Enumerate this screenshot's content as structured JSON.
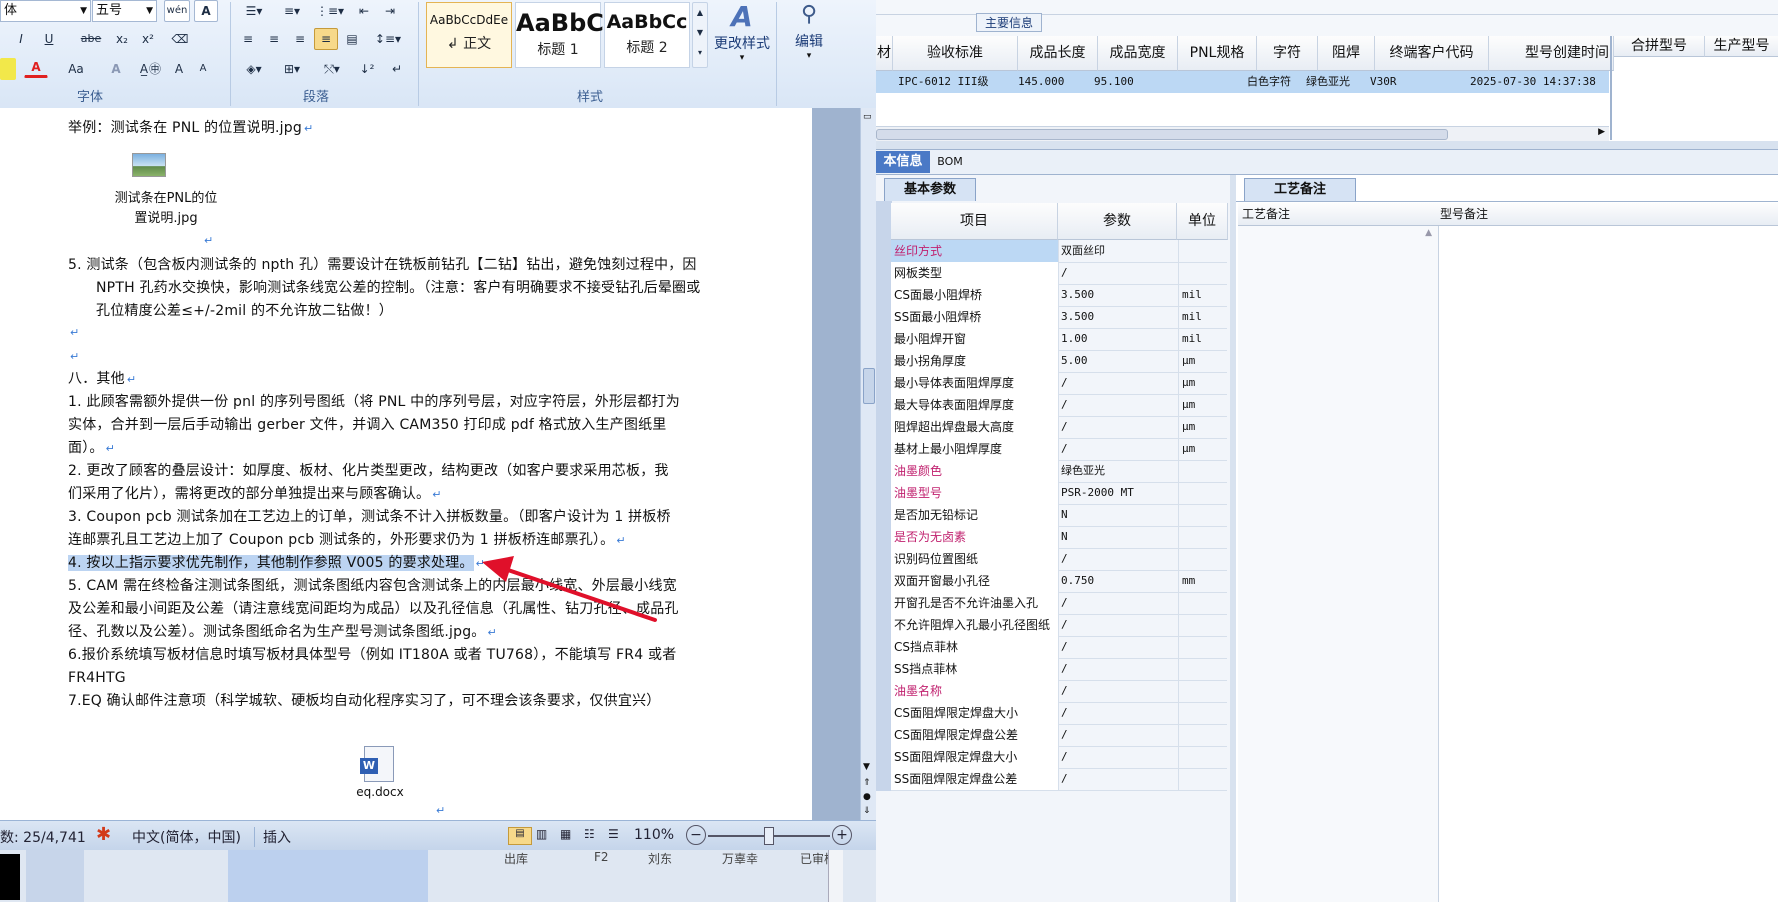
{
  "ribbon": {
    "font_name": "体",
    "font_size": "五号",
    "group_font": "字体",
    "group_paragraph": "段落",
    "group_styles": "样式",
    "styles": [
      {
        "sample": "AaBbCcDdEe",
        "name": "↲ 正文"
      },
      {
        "sample": "AaBbC",
        "name": "标题 1"
      },
      {
        "sample": "AaBbCc",
        "name": "标题 2"
      }
    ],
    "change_styles": "更改样式",
    "edit": "编辑",
    "btn_bold_i": "I",
    "btn_u": "U",
    "btn_abe": "abe",
    "btn_sub": "x₂",
    "btn_sup": "x²",
    "btn_aa": "Aa",
    "btn_grow": "A",
    "btn_shrink": "A"
  },
  "doc": {
    "p1": "举例：测试条在 PNL 的位置说明.jpg",
    "img_caption_1": "测试条在PNL的位",
    "img_caption_2": "置说明.jpg",
    "p5": "5.  测试条（包含板内测试条的 npth 孔）需要设计在铣板前钻孔【二钻】钻出，避免蚀刻过程中，因 NPTH 孔药水交换快，影响测试条线宽公差的控制。（注意：客户有明确要求不接受钻孔后晕圈或孔位精度公差≤+/-2mil 的不允许放二钻做！）",
    "h8": "八．其他",
    "o1": "1.  此顾客需额外提供一份 pnl 的序列号图纸（将 PNL 中的序列号层，对应字符层，外形层都打为实体，合并到一层后手动输出 gerber 文件，并调入 CAM350 打印成 pdf 格式放入生产图纸里面）。",
    "o2": "2.  更改了顾客的叠层设计：如厚度、板材、化片类型更改，结构更改（如客户要求采用芯板，我们采用了化片），需将更改的部分单独提出来与顾客确认。",
    "o3": "3.  Coupon pcb 测试条加在工艺边上的订单，测试条不计入拼板数量。（即客户设计为 1 拼板桥连邮票孔且工艺边上加了 Coupon pcb 测试条的，外形要求仍为 1 拼板桥连邮票孔）。",
    "o4": "4.  按以上指示要求优先制作，其他制作参照 V005 的要求处理。",
    "o5": "5.  CAM 需在终检备注测试条图纸，测试条图纸内容包含测试条上的内层最小线宽、外层最小线宽及公差和最小间距及公差（请注意线宽间距均为成品）以及孔径信息（孔属性、钻刀孔径、成品孔径、孔数以及公差）。测试条图纸命名为生产型号测试条图纸.jpg。",
    "o6": "6.报价系统填写板材信息时填写板材具体型号（例如 IT180A 或者 TU768），不能填写 FR4 或者 FR4HTG",
    "o7": "7.EQ 确认邮件注意项（科学城软、硬板均自动化程序实习了，可不理会该条要求，仅供宜兴）",
    "attach_name": "eq.docx",
    "mark": "↵"
  },
  "status": {
    "words": "数: 25/4,741",
    "lang": "中文(简体，中国)",
    "mode": "插入",
    "zoom": "110%"
  },
  "erp": {
    "section_title": "主要信息",
    "headers": [
      "材",
      "验收标准",
      "成品长度",
      "成品宽度",
      "PNL规格",
      "字符",
      "阻焊",
      "终端客户代码",
      "型号创建时间"
    ],
    "right_headers": [
      "合拼型号",
      "生产型号"
    ],
    "row": {
      "standard": "IPC-6012 III级",
      "length": "145.000",
      "width": "95.100",
      "char": "白色字符",
      "mask": "绿色亚光",
      "code": "V30R",
      "created": "2025-07-30 14:37:38"
    },
    "tab_basic_info": "本信息",
    "tab_bom": "BOM",
    "tab_params": "基本参数",
    "tab_process": "工艺备注",
    "grid_headers": [
      "项目",
      "参数",
      "单位"
    ],
    "remark_headers": [
      "工艺备注",
      "型号备注"
    ],
    "params": [
      {
        "item": "丝印方式",
        "value": "双面丝印",
        "unit": "",
        "pink": true,
        "sel": true
      },
      {
        "item": "网板类型",
        "value": "/",
        "unit": ""
      },
      {
        "item": "CS面最小阻焊桥",
        "value": "3.500",
        "unit": "mil"
      },
      {
        "item": "SS面最小阻焊桥",
        "value": "3.500",
        "unit": "mil"
      },
      {
        "item": "最小阻焊开窗",
        "value": "1.00",
        "unit": "mil"
      },
      {
        "item": "最小拐角厚度",
        "value": "5.00",
        "unit": "μm"
      },
      {
        "item": "最小导体表面阻焊厚度",
        "value": "/",
        "unit": "μm"
      },
      {
        "item": "最大导体表面阻焊厚度",
        "value": "/",
        "unit": "μm"
      },
      {
        "item": "阻焊超出焊盘最大高度",
        "value": "/",
        "unit": "μm"
      },
      {
        "item": "基材上最小阻焊厚度",
        "value": "/",
        "unit": "μm"
      },
      {
        "item": "油墨颜色",
        "value": "绿色亚光",
        "unit": "",
        "pink": true
      },
      {
        "item": "油墨型号",
        "value": "PSR-2000 MT",
        "unit": "",
        "pink": true
      },
      {
        "item": "是否加无铅标记",
        "value": "N",
        "unit": ""
      },
      {
        "item": "是否为无卤素",
        "value": "N",
        "unit": "",
        "pink": true
      },
      {
        "item": "识别码位置图纸",
        "value": "/",
        "unit": ""
      },
      {
        "item": "双面开窗最小孔径",
        "value": "0.750",
        "unit": "mm"
      },
      {
        "item": "开窗孔是否不允许油墨入孔",
        "value": "/",
        "unit": ""
      },
      {
        "item": "不允许阻焊入孔最小孔径图纸",
        "value": "/",
        "unit": ""
      },
      {
        "item": "CS挡点菲林",
        "value": "/",
        "unit": ""
      },
      {
        "item": "SS挡点菲林",
        "value": "/",
        "unit": ""
      },
      {
        "item": "油墨名称",
        "value": "/",
        "unit": "",
        "pink": true
      },
      {
        "item": "CS面阻焊限定焊盘大小",
        "value": "/",
        "unit": ""
      },
      {
        "item": "CS面阻焊限定焊盘公差",
        "value": "/",
        "unit": ""
      },
      {
        "item": "SS面阻焊限定焊盘大小",
        "value": "/",
        "unit": ""
      },
      {
        "item": "SS面阻焊限定焊盘公差",
        "value": "/",
        "unit": ""
      }
    ],
    "bottom_cells": [
      "出库",
      "F2",
      "刘东",
      "万辜幸",
      "已审核"
    ]
  },
  "colors": {
    "accent": "#3a7bd5",
    "highlight": "#bcd4f2",
    "arrow": "#e0102a",
    "pink": "#c0206e"
  }
}
